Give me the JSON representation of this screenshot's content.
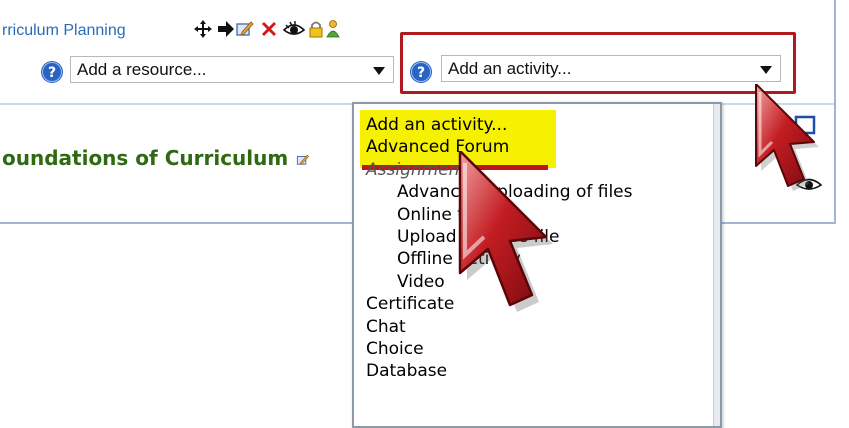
{
  "topic_link": "rriculum Planning",
  "resource_select": {
    "value": "Add a resource..."
  },
  "activity_select": {
    "value": "Add an activity..."
  },
  "section_title": "oundations of Curriculum",
  "dropdown": {
    "options": [
      {
        "label": "Add an activity...",
        "highlighted": true,
        "indent": false,
        "group": false
      },
      {
        "label": "Advanced Forum",
        "highlighted": true,
        "indent": false,
        "group": false
      },
      {
        "label": "Assignments",
        "highlighted": false,
        "indent": false,
        "group": true
      },
      {
        "label": "Advanced uploading of files",
        "highlighted": false,
        "indent": true,
        "group": false
      },
      {
        "label": "Online text",
        "highlighted": false,
        "indent": true,
        "group": false
      },
      {
        "label": "Upload a single file",
        "highlighted": false,
        "indent": true,
        "group": false
      },
      {
        "label": "Offline activity",
        "highlighted": false,
        "indent": true,
        "group": false
      },
      {
        "label": "Video",
        "highlighted": false,
        "indent": true,
        "group": false
      },
      {
        "label": "Certificate",
        "highlighted": false,
        "indent": false,
        "group": false
      },
      {
        "label": "Chat",
        "highlighted": false,
        "indent": false,
        "group": false
      },
      {
        "label": "Choice",
        "highlighted": false,
        "indent": false,
        "group": false
      },
      {
        "label": "Database",
        "highlighted": false,
        "indent": false,
        "group": false
      }
    ]
  },
  "colors": {
    "link": "#2a6bb8",
    "section_title": "#2f6a12",
    "callout_border": "#b01a1e",
    "highlight": "#f5f100",
    "help_icon": "#2a63c4"
  },
  "icons": [
    "move-icon",
    "move-right-icon",
    "edit-icon",
    "delete-icon",
    "hide-icon",
    "lock-icon",
    "role-icon",
    "help-icon",
    "pointer-cursor-icon"
  ]
}
